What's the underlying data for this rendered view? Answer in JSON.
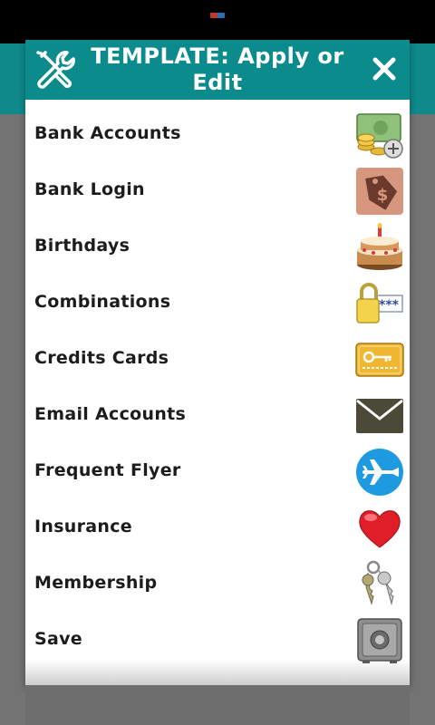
{
  "dialog": {
    "title": "TEMPLATE:  Apply or Edit",
    "close_label": "×"
  },
  "templates": [
    {
      "label": "Bank Accounts",
      "icon": "money-icon"
    },
    {
      "label": "Bank Login",
      "icon": "dollar-tag-icon"
    },
    {
      "label": "Birthdays",
      "icon": "birthday-cake-icon"
    },
    {
      "label": "Combinations",
      "icon": "padlock-password-icon"
    },
    {
      "label": "Credits Cards",
      "icon": "credit-card-icon"
    },
    {
      "label": "Email Accounts",
      "icon": "envelope-icon"
    },
    {
      "label": "Frequent Flyer",
      "icon": "airplane-icon"
    },
    {
      "label": "Insurance",
      "icon": "heart-icon"
    },
    {
      "label": "Membership",
      "icon": "keys-icon"
    },
    {
      "label": "Save",
      "icon": "safe-icon"
    }
  ],
  "colors": {
    "header": "#0b8b8c",
    "app_bar": "#0f8a8b",
    "backdrop": "#737373"
  }
}
